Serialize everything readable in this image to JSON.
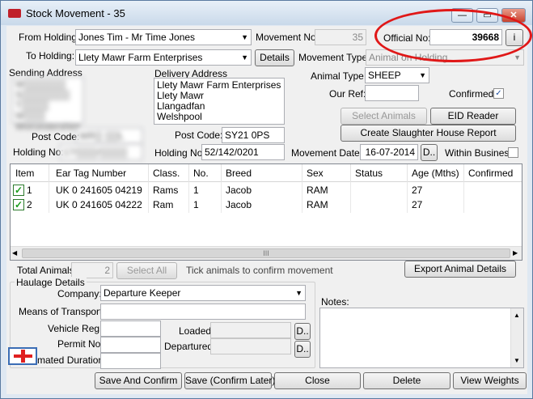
{
  "window": {
    "title": "Stock Movement - 35"
  },
  "header": {
    "from_holding_label": "From Holding:",
    "from_holding_value": "Jones Tim - Mr Time Jones",
    "to_holding_label": "To Holding:",
    "to_holding_value": "Llety Mawr Farm Enterprises",
    "details_button": "Details",
    "movement_no_label": "Movement No:",
    "movement_no_value": "35",
    "official_no_label": "Official No:",
    "official_no_value": "39668",
    "official_info_button": "i",
    "movement_type_label": "Movement Type:",
    "movement_type_value": "Animal on Holding",
    "animal_type_label": "Animal Type:",
    "animal_type_value": "SHEEP",
    "our_ref_label": "Our Ref:",
    "our_ref_value": "",
    "confirmed_label": "Confirmed:",
    "confirmed_checked": true
  },
  "sending": {
    "label": "Sending Address",
    "lines": [
      "W▒▒▒▒▒▒",
      "S▒▒▒▒▒▒▒",
      "T▒▒▒▒ W▒▒▒",
      "Worcestershire"
    ],
    "postcode_label": "Post Code:",
    "postcode_value": "WR▒ ▒▒L",
    "holding_no_label": "Holding No:",
    "holding_no_value": "17/▒▒▒/▒▒▒▒"
  },
  "delivery": {
    "label": "Delivery Address",
    "lines": [
      "Llety Mawr Farm Enterprises",
      "Llety Mawr",
      "Llangadfan",
      "Welshpool"
    ],
    "postcode_label": "Post Code:",
    "postcode_value": "SY21 0PS",
    "holding_no_label": "Holding No:",
    "holding_no_value": "52/142/0201"
  },
  "actions": {
    "select_animals": "Select Animals",
    "eid_reader": "EID Reader",
    "create_report": "Create Slaughter House Report"
  },
  "movement_date": {
    "label": "Movement Date:",
    "value": "16-07-2014",
    "button": "D.."
  },
  "within_business_label": "Within Business",
  "grid": {
    "columns": [
      "Item",
      "Ear Tag Number",
      "Class.",
      "No.",
      "Breed",
      "Sex",
      "Status",
      "Age (Mths)",
      "Confirmed"
    ],
    "rows": [
      {
        "item": "1",
        "tag": "UK 0 241605 04219",
        "class": "Rams",
        "no": "1",
        "breed": "Jacob",
        "sex": "RAM",
        "status": "",
        "age": "27",
        "confirmed": ""
      },
      {
        "item": "2",
        "tag": "UK 0 241605 04222",
        "class": "Ram",
        "no": "1",
        "breed": "Jacob",
        "sex": "RAM",
        "status": "",
        "age": "27",
        "confirmed": ""
      }
    ],
    "scroll_grip": "III"
  },
  "totals": {
    "total_label": "Total Animals:",
    "total_value": "2",
    "select_all": "Select All",
    "hint": "Tick animals to confirm movement",
    "export_button": "Export Animal Details"
  },
  "haulage": {
    "label": "Haulage Details",
    "company_label": "Company:",
    "company_value": "Departure Keeper",
    "transport_label": "Means of Transport:",
    "transport_value": "",
    "vehicle_label": "Vehicle Reg:",
    "vehicle_value": "",
    "permit_label": "Permit No:",
    "permit_value": "",
    "duration_label": "Estimated Duration:",
    "duration_value": "",
    "loaded_label": "Loaded:",
    "loaded_value": "",
    "departured_label": "Departured:",
    "departured_value": "",
    "date_button": "D.."
  },
  "notes": {
    "label": "Notes:",
    "value": ""
  },
  "footer": {
    "save_confirm": "Save And Confirm",
    "save_later": "Save (Confirm Later)",
    "close": "Close",
    "delete": "Delete",
    "view_weights": "View Weights"
  },
  "colors": {
    "annotation_circle": "#e01818",
    "flag_cross": "#e02020"
  }
}
